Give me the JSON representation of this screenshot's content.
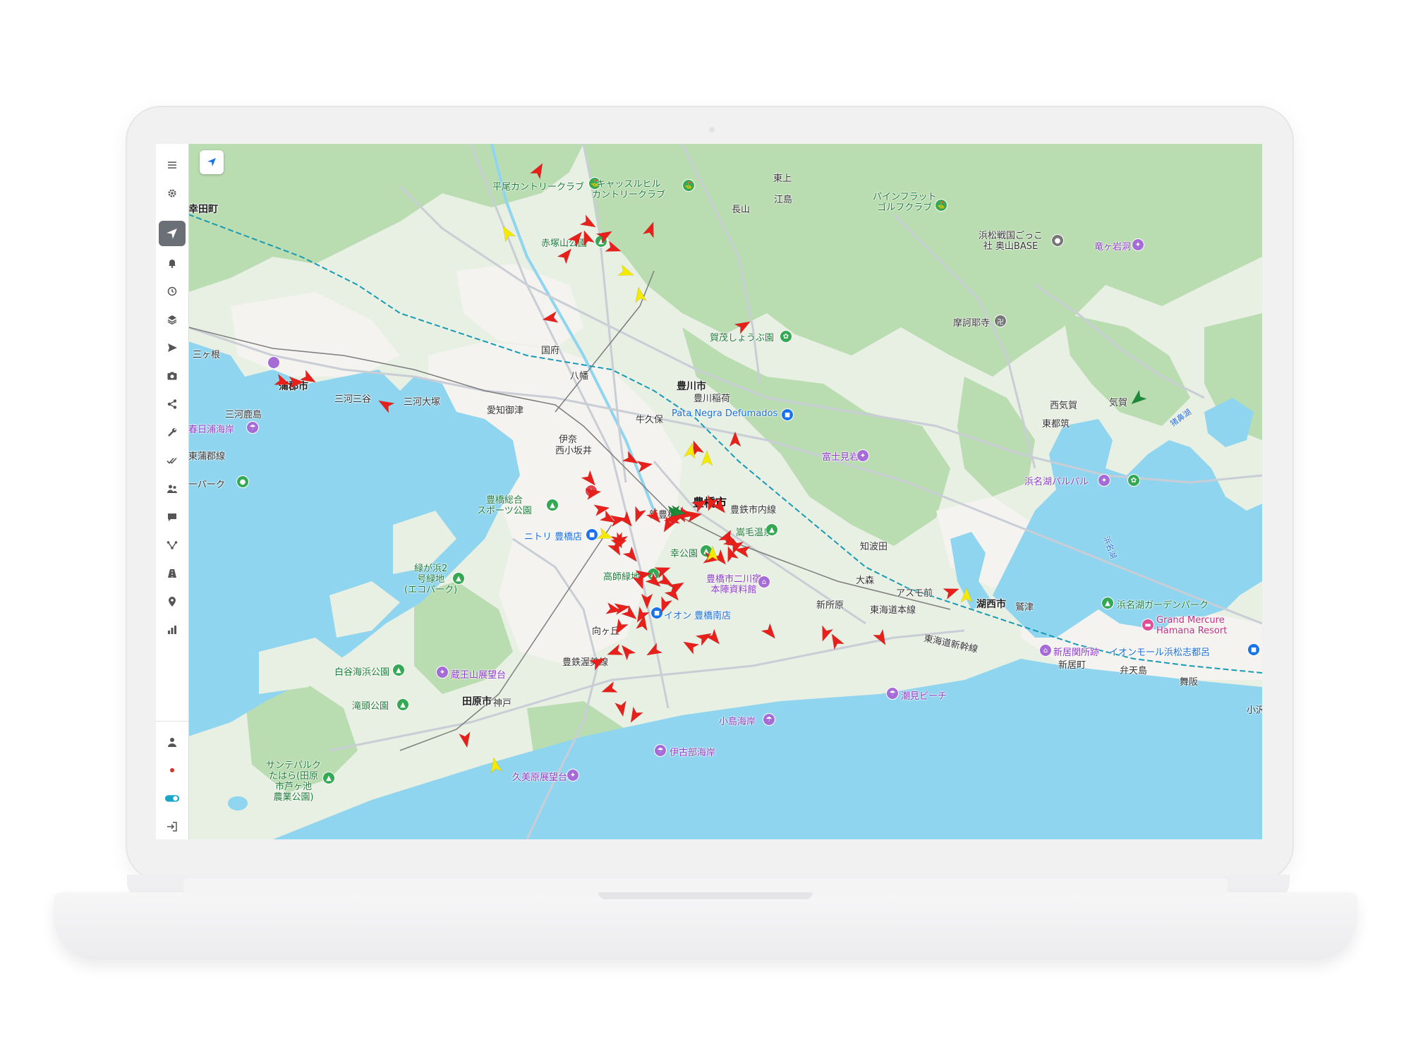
{
  "sidebar": {
    "items": [
      {
        "name": "menu-icon",
        "active": false
      },
      {
        "name": "settings-icon",
        "active": false
      },
      {
        "name": "navigation-icon",
        "active": true
      },
      {
        "name": "bell-icon",
        "active": false
      },
      {
        "name": "history-icon",
        "active": false
      },
      {
        "name": "layers-icon",
        "active": false
      },
      {
        "name": "send-icon",
        "active": false
      },
      {
        "name": "camera-icon",
        "active": false
      },
      {
        "name": "share-icon",
        "active": false
      },
      {
        "name": "wrench-icon",
        "active": false
      },
      {
        "name": "double-check-icon",
        "active": false
      },
      {
        "name": "users-icon",
        "active": false
      },
      {
        "name": "chat-icon",
        "active": false
      },
      {
        "name": "route-icon",
        "active": false
      },
      {
        "name": "road-icon",
        "active": false
      },
      {
        "name": "map-pin-icon",
        "active": false
      },
      {
        "name": "bar-chart-icon",
        "active": false
      }
    ],
    "bottom_items": [
      {
        "name": "user-icon"
      },
      {
        "name": "status-dot-icon",
        "color": "#d9342b"
      },
      {
        "name": "toggle-icon",
        "color": "#1aa5c9"
      },
      {
        "name": "logout-icon"
      }
    ]
  },
  "map": {
    "land_color": "#e8efe3",
    "forest_color": "#b9dcb0",
    "water_color": "#8fd5ef",
    "urban_color": "#f2f1ee",
    "labels": {
      "toyohashi": "豊橋市",
      "toyokawa": "豊川市",
      "gamagori": "蒲郡市",
      "kosai": "湖西市",
      "tahara": "田原市",
      "mikawamiya": "三河三谷",
      "mikawaotsuka": "三河大塚",
      "mikawakashima": "三河鹿島",
      "aichimito": "愛知御津",
      "kokufu": "国府",
      "yawata": "八幡",
      "toyokawainari": "豊川稲荷",
      "ushikubo": "牛久保",
      "ina": "伊奈",
      "nishikozakai": "西小坂井",
      "shintoyohashi": "新豊橋",
      "toyotetsu": "豊鉄市内線",
      "sankagane": "三ヶ根",
      "kotadacho": "幸田町",
      "higashigamagori": "東蒲郡線",
      "kasugaura": "春日浦海岸",
      "hiraocountry": "平尾カントリークラブ",
      "castlehill": "キャッスルヒル\nカントリークラブ",
      "akatsukayama": "赤塚山公園",
      "kamoshoubu": "賀茂しょうぶ園",
      "patanegra": "Pata Negra Defumados",
      "fujimiiwa": "富士見岩",
      "nagayama": "長山",
      "higashiue": "東上",
      "ejima": "江島",
      "pineflat": "パインフラット\nゴルフクラブ",
      "hamamatsusengoku": "浜松戦国ごっこ\n社 奥山BASE",
      "ryugaiwa": "竜ヶ岩洞",
      "masourinji": "摩訶耶寺",
      "nishikiga": "西気賀",
      "kiga": "気賀",
      "higashitsuzuki": "東都筑",
      "hamanakopalpal": "浜名湖パルパル",
      "toyohashisogo": "豊橋総合\nスポーツ公園",
      "nitori": "ニトリ 豊橋店",
      "takashiryokuchi": "高師緑地",
      "saiwaikouen": "幸公園",
      "yuminoge": "嵩毛温泉",
      "futagawa": "豊橋市二川宿\n本陣資料館",
      "aeon": "イオン 豊橋南店",
      "mukaigaoka": "向ヶ丘",
      "atsumi": "豊鉄渥美線",
      "midorigahama": "緑が浜2\n号緑地\n(エコパーク)",
      "shiroyakaihin": "白谷海浜公園",
      "zaouzan": "蔵王山展望台",
      "takigashira": "滝頭公園",
      "taharashi_kanbe": "神戸",
      "suntopal": "サンテパルク\nたはら(田原\n市芦ヶ池\n農業公園)",
      "kumihara": "久美原展望台",
      "ikobe": "伊古部海岸",
      "kojima": "小島海岸",
      "shiomi": "潮見ビーチ",
      "chitoseda": "知波田",
      "omori": "大森",
      "asumomae": "アスモ前",
      "shinjohara": "新所原",
      "tokaidohonsen": "東海道本線",
      "tokaidoshinkansen": "東海道新幹線",
      "washizu": "鷲津",
      "shinjosekishoato": "新居関所跡",
      "arai": "新居町",
      "hamanakogarden": "浜名湖ガーデンパーク",
      "grandmercure": "Grand Mercure\nHamana Resort",
      "aeonmall": "イオンモール浜松志都呂",
      "bentenjima": "弁天島",
      "maisaka": "舞阪",
      "kozawa": "小沢",
      "greenpark": "ーパーク",
      "hamanako": "浜名湖",
      "inasa": "猪鼻湖"
    }
  },
  "markers": {
    "red_color": "#e8201c",
    "yellow_color": "#f5e900",
    "green_color": "#1d8a3a"
  }
}
